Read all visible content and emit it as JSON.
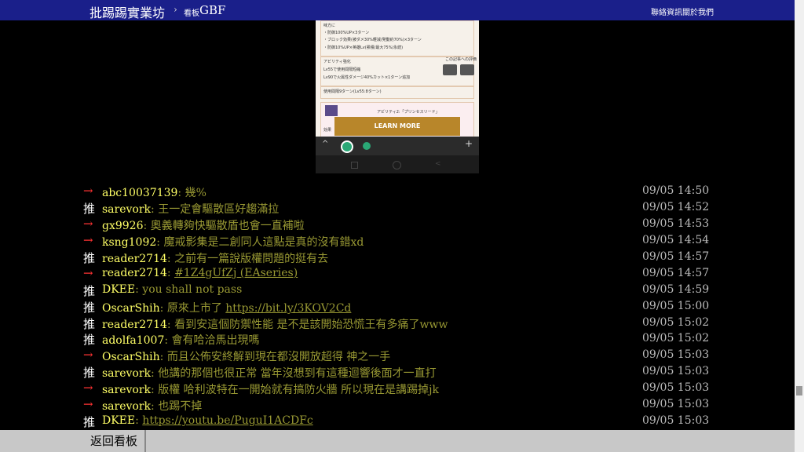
{
  "header": {
    "brand": "批踢踢實業坊",
    "separator": "›",
    "board_prefix": "看板",
    "board_name": "GBF",
    "contact": "聯絡資訊",
    "about": "關於我們"
  },
  "image": {
    "lines": [
      {
        "text": "味方に",
        "red": false
      },
      {
        "text": "・防御100%UP×3ターン",
        "red": false
      },
      {
        "text": "・ブロック効果(被ダメ30%軽減/発動約70%)×3ターン",
        "red": false
      },
      {
        "text": "・防御10%UP×英雄Lv(累積/最大75%/永続)",
        "red": false
      },
      {
        "text": "アビリティ強化",
        "red": false
      },
      {
        "text": "Lv55で使用間隔短縮",
        "red": false
      },
      {
        "text": "Lv90で火属性ダメージ40%カット×1ターン追加",
        "red": false
      },
      {
        "text": "使用間隔9ターン(Lv55:8ターン)",
        "red": false
      },
      {
        "text": "アビリティ2:「プリンセスリード」",
        "red": false
      },
      {
        "text": "効果",
        "red": false
      }
    ],
    "review_text": "この記事への評価",
    "learn_more": "LEARN MORE",
    "tab_up": "^",
    "tab_plus": "+"
  },
  "comments": [
    {
      "tag": "→",
      "user": "abc10037139",
      "msg": ": 幾%",
      "time": "09/05 14:50"
    },
    {
      "tag": "推",
      "user": "sarevork",
      "msg": ": 王一定會驅散區好趨滿拉",
      "time": "09/05 14:52"
    },
    {
      "tag": "→",
      "user": "gx9926",
      "msg": ": 奧義轉夠快驅散盾也會一直補啦",
      "time": "09/05 14:53"
    },
    {
      "tag": "→",
      "user": "ksng1092",
      "msg": ": 魔戒影集是二創同人這點是真的沒有錯xd",
      "time": "09/05 14:54"
    },
    {
      "tag": "推",
      "user": "reader2714",
      "msg": ": 之前有一篇說版權問題的挺有去",
      "time": "09/05 14:57"
    },
    {
      "tag": "→",
      "user": "reader2714",
      "msg": ": ",
      "link": "#1Z4gUfZj (EAseries)",
      "time": "09/05 14:57"
    },
    {
      "tag": "推",
      "user": "DKEE",
      "msg": ": you shall not pass",
      "time": "09/05 14:59"
    },
    {
      "tag": "推",
      "user": "OscarShih",
      "msg": ": 原來上市了 ",
      "link": "https://bit.ly/3KOV2Cd",
      "time": "09/05 15:00"
    },
    {
      "tag": "推",
      "user": "reader2714",
      "msg": ": 看到安這個防禦性能 是不是該開始恐慌王有多痛了www",
      "time": "09/05 15:02"
    },
    {
      "tag": "推",
      "user": "adolfa1007",
      "msg": ": 會有哈洽馬出現嗎",
      "time": "09/05 15:02"
    },
    {
      "tag": "→",
      "user": "OscarShih",
      "msg": ": 而且公佈安終解到現在都沒開放超得 神之一手",
      "time": "09/05 15:03"
    },
    {
      "tag": "推",
      "user": "sarevork",
      "msg": ": 他講的那個也很正常 當年沒想到有這種迴響後面才一直打",
      "time": "09/05 15:03"
    },
    {
      "tag": "→",
      "user": "sarevork",
      "msg": ": 版權 哈利波特在一開始就有搞防火牆 所以現在是講踢掉jk",
      "time": "09/05 15:03"
    },
    {
      "tag": "→",
      "user": "sarevork",
      "msg": ": 也踢不掉",
      "time": "09/05 15:03"
    },
    {
      "tag": "推",
      "user": "DKEE",
      "msg": ": ",
      "link": "https://youtu.be/PuguI1ACDFc",
      "time": "09/05 15:03"
    }
  ],
  "footer": {
    "back_label": "返回看板"
  }
}
